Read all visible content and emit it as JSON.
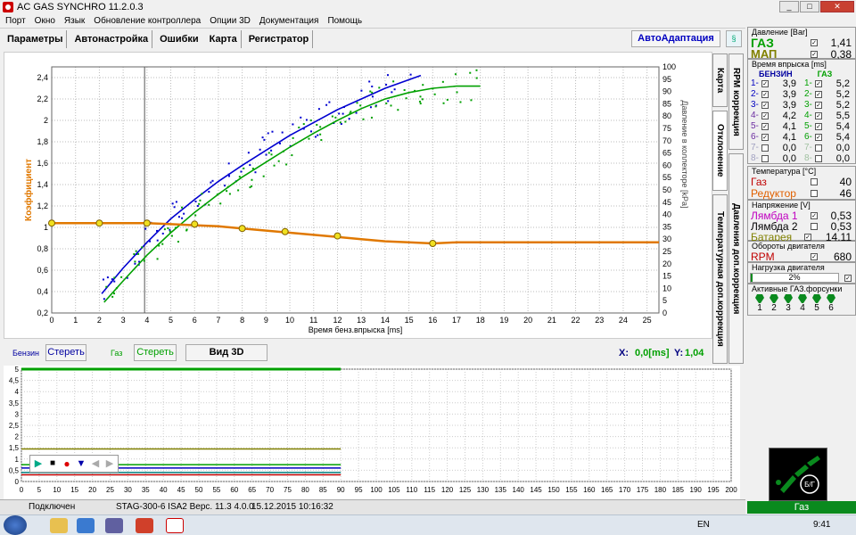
{
  "window": {
    "title": "AC GAS SYNCHRO  11.2.0.3",
    "buttons": [
      "_",
      "□",
      "✕"
    ]
  },
  "menu": [
    "Порт",
    "Окно",
    "Язык",
    "Обновление контроллера",
    "Опции 3D",
    "Документация",
    "Помощь"
  ],
  "toolbar": {
    "tabs": [
      "Параметры",
      "Автонастройка",
      "Ошибки",
      "Карта",
      "Регистратор"
    ],
    "autoadapt": "АвтоАдаптация"
  },
  "side_tabs": [
    "Карта",
    "RPM коррекция",
    "Отклонение",
    "Температурная доп.коррекция",
    "Давления доп.коррекция"
  ],
  "chart_data": {
    "type": "scatter",
    "xlabel": "Время бенз.впрыска [ms]",
    "ylabel_left": "Коэффициент",
    "ylabel_right": "Давление в коллекторе [kPa]",
    "xlim": [
      0,
      25.5
    ],
    "ylim_left": [
      0.2,
      2.5
    ],
    "ylim_right": [
      0,
      100
    ],
    "x_ticks": [
      0,
      1,
      2,
      3,
      4,
      5,
      6,
      7,
      8,
      9,
      10,
      11,
      12,
      13,
      14,
      15,
      16,
      17,
      18,
      19,
      20,
      21,
      22,
      23,
      24,
      25
    ],
    "y_ticks_left": [
      "0,2",
      "0,4",
      "0,6",
      "0,8",
      "1",
      "1,2",
      "1,4",
      "1,6",
      "1,8",
      "2",
      "2,2",
      "2,4"
    ],
    "y_ticks_right": [
      0,
      5,
      10,
      15,
      20,
      25,
      30,
      35,
      40,
      45,
      50,
      55,
      60,
      65,
      70,
      75,
      80,
      85,
      90,
      95,
      100
    ],
    "series": [
      {
        "name": "Бензин",
        "color": "#0000d0",
        "values": [
          [
            2.1,
            0.38
          ],
          [
            3,
            0.62
          ],
          [
            4,
            0.86
          ],
          [
            5,
            1.08
          ],
          [
            6,
            1.26
          ],
          [
            7,
            1.43
          ],
          [
            8,
            1.58
          ],
          [
            9,
            1.72
          ],
          [
            10,
            1.86
          ],
          [
            11,
            1.98
          ],
          [
            12,
            2.1
          ],
          [
            13,
            2.2
          ],
          [
            14,
            2.3
          ],
          [
            15.5,
            2.42
          ]
        ]
      },
      {
        "name": "Газ",
        "color": "#00a000",
        "values": [
          [
            2.2,
            0.3
          ],
          [
            3,
            0.5
          ],
          [
            4,
            0.74
          ],
          [
            5,
            0.95
          ],
          [
            6,
            1.14
          ],
          [
            7,
            1.31
          ],
          [
            8,
            1.47
          ],
          [
            9,
            1.61
          ],
          [
            10,
            1.75
          ],
          [
            11,
            1.88
          ],
          [
            12,
            2.0
          ],
          [
            13,
            2.11
          ],
          [
            14,
            2.2
          ],
          [
            15,
            2.26
          ],
          [
            16,
            2.3
          ],
          [
            17,
            2.32
          ],
          [
            18,
            2.32
          ]
        ]
      },
      {
        "name": "Коэффициент",
        "color": "#e07800",
        "values": [
          [
            0,
            1.04
          ],
          [
            1,
            1.04
          ],
          [
            2,
            1.04
          ],
          [
            3,
            1.04
          ],
          [
            4,
            1.04
          ],
          [
            5,
            1.03
          ],
          [
            6,
            1.02
          ],
          [
            7,
            1.01
          ],
          [
            8,
            0.99
          ],
          [
            9,
            0.97
          ],
          [
            10,
            0.95
          ],
          [
            11,
            0.93
          ],
          [
            12,
            0.91
          ],
          [
            13,
            0.89
          ],
          [
            14,
            0.87
          ],
          [
            15,
            0.86
          ],
          [
            16,
            0.85
          ],
          [
            17,
            0.86
          ],
          [
            18,
            0.86
          ],
          [
            19,
            0.86
          ],
          [
            20,
            0.86
          ],
          [
            21,
            0.86
          ],
          [
            22,
            0.86
          ],
          [
            23,
            0.86
          ],
          [
            24,
            0.86
          ],
          [
            25.5,
            0.86
          ]
        ]
      }
    ],
    "markers": [
      [
        0,
        1.04
      ],
      [
        2,
        1.04
      ],
      [
        4,
        1.04
      ],
      [
        6,
        1.03
      ],
      [
        8,
        0.99
      ],
      [
        9.8,
        0.96
      ],
      [
        12,
        0.92
      ],
      [
        16,
        0.85
      ]
    ],
    "cursor_x": 3.9
  },
  "controls": {
    "benzin_label": "Бензин",
    "benzin_clear": "Стереть",
    "gaz_label": "Газ",
    "gaz_clear": "Стереть",
    "view3d": "Вид 3D",
    "x_label": "X:",
    "x_value": "0,0[ms]",
    "y_label": "Y:",
    "y_value": "1,04"
  },
  "recorder": {
    "y_ticks": [
      "5",
      "4,5",
      "4",
      "3,5",
      "3",
      "2,5",
      "2",
      "1,5",
      "1",
      "0,5",
      "0"
    ],
    "x_ticks": [
      0,
      5,
      10,
      15,
      20,
      25,
      30,
      35,
      40,
      45,
      50,
      55,
      60,
      65,
      70,
      75,
      80,
      85,
      90,
      95,
      100,
      105,
      110,
      115,
      120,
      125,
      130,
      135,
      140,
      145,
      150,
      155,
      160,
      165,
      170,
      175,
      180,
      185,
      190,
      195,
      200
    ],
    "xlim": [
      0,
      200
    ],
    "ylim": [
      0,
      5
    ],
    "traces": [
      {
        "color": "#00a000",
        "value": 5.0,
        "to": 90
      },
      {
        "color": "#808000",
        "value": 1.45,
        "to": 90
      },
      {
        "color": "#00a000",
        "value": 0.75,
        "to": 90
      },
      {
        "color": "#0000c0",
        "value": 0.6,
        "to": 90
      },
      {
        "color": "#008080",
        "value": 0.4,
        "to": 90
      },
      {
        "color": "#c00000",
        "value": 0.3,
        "to": 90
      }
    ]
  },
  "right": {
    "pressure": {
      "header": "Давление [Bar]",
      "gas_label": "ГАЗ",
      "gas_value": "1,41",
      "map_label": "МАП",
      "map_value": "0,38"
    },
    "injection": {
      "header": "Время впрыска [ms]",
      "col_benzin": "БЕНЗИН",
      "col_gaz": "ГАЗ",
      "rows": [
        {
          "n": "1",
          "b": "3,9",
          "g": "5,2",
          "color": "#0000c0"
        },
        {
          "n": "2",
          "b": "3,9",
          "g": "5,2",
          "color": "#0000c0"
        },
        {
          "n": "3",
          "b": "3,9",
          "g": "5,2",
          "color": "#0000c0"
        },
        {
          "n": "4",
          "b": "4,2",
          "g": "5,5",
          "color": "#6b2ca0"
        },
        {
          "n": "5",
          "b": "4,1",
          "g": "5,4",
          "color": "#6b2ca0"
        },
        {
          "n": "6",
          "b": "4,1",
          "g": "5,4",
          "color": "#6b2ca0"
        },
        {
          "n": "7",
          "b": "0,0",
          "g": "0,0",
          "color": "#a0a0c0"
        },
        {
          "n": "8",
          "b": "0,0",
          "g": "0,0",
          "color": "#a0a0c0"
        }
      ]
    },
    "temperature": {
      "header": "Температура  [°C]",
      "gas_label": "Газ",
      "gas_value": "40",
      "red_label": "Редуктор",
      "red_value": "46"
    },
    "voltage": {
      "header": "Напряжение [V]",
      "l1_label": "Лямбда 1",
      "l1_value": "0,53",
      "l2_label": "Лямбда 2",
      "l2_value": "0,53",
      "bat_label": "Батарея",
      "bat_value": "14,11"
    },
    "rpm": {
      "header": "Обороты двигателя",
      "label": "RPM",
      "value": "680"
    },
    "load": {
      "header": "Нагрузка двигателя",
      "value": "2%",
      "percent": 2
    },
    "injectors": {
      "header": "Активные ГАЗ.форсунки",
      "numbers": [
        "1",
        "2",
        "3",
        "4",
        "5",
        "6"
      ]
    },
    "switch_label": "Б/Г",
    "mode": "Газ"
  },
  "status": {
    "connection": "Подключен",
    "device": "STAG-300-6 ISA2  Верс. 11.3  4.0.0",
    "datetime": "15.12.2015 10:16:32"
  },
  "taskbar": {
    "lang": "EN",
    "time": "9:41"
  }
}
